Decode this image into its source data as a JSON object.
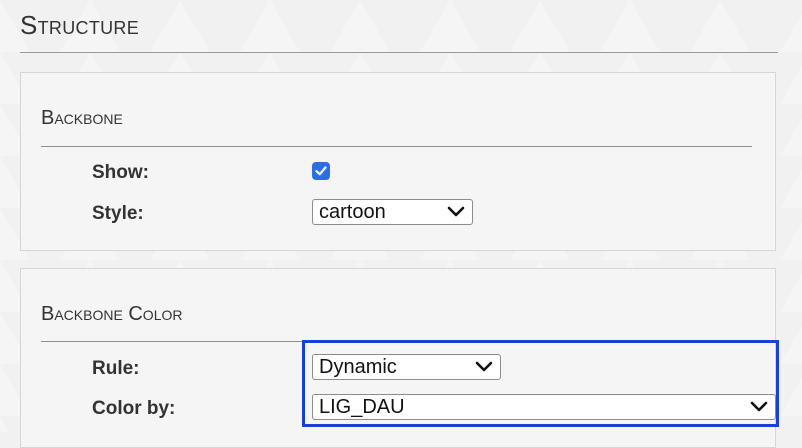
{
  "page": {
    "title": "Structure"
  },
  "backbone": {
    "section_title": "Backbone",
    "show_label": "Show:",
    "show_checked": true,
    "style_label": "Style:",
    "style_value": "cartoon"
  },
  "backbone_color": {
    "section_title": "Backbone Color",
    "rule_label": "Rule:",
    "rule_value": "Dynamic",
    "color_by_label": "Color by:",
    "color_by_value": "LIG_DAU"
  },
  "colors": {
    "accent": "#2c6fe0",
    "highlight_border": "#1740d6"
  },
  "icons": {
    "checkbox": "checkmark-icon",
    "dropdown": "chevron-down-icon"
  }
}
